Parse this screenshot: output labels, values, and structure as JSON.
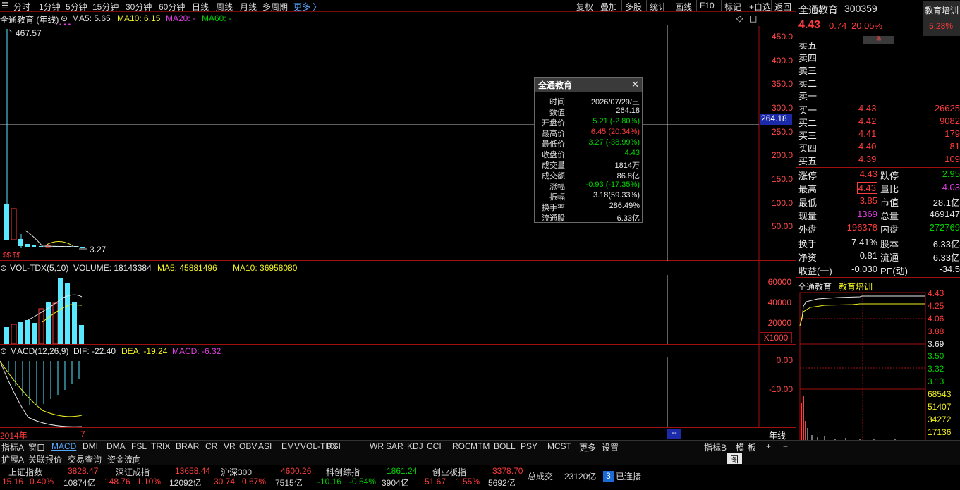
{
  "toolbar": {
    "left": [
      "分时",
      "1分钟",
      "5分钟",
      "15分钟",
      "30分钟",
      "60分钟",
      "日线",
      "周线",
      "月线",
      "多周期",
      "更多 〉"
    ],
    "right": [
      "复权",
      "叠加",
      "多股",
      "统计",
      "画线",
      "F10",
      "标记",
      "+自选",
      "返回"
    ]
  },
  "kline": {
    "title": "全通教育 (年线)",
    "ma5": "MA5: 5.65",
    "ma10": "MA10: 6.15",
    "ma20": "MA20: -",
    "ma60": "MA60: -",
    "high_label": "467.57",
    "low_label": "3.27",
    "axis": [
      "450.0",
      "400.0",
      "350.0",
      "300.0",
      "250.0",
      "200.0",
      "150.0",
      "100.0",
      "50.00"
    ],
    "crosshair_value": "264.18"
  },
  "volume": {
    "title": "VOL-TDX(5,10)",
    "vol": "VOLUME: 18143384",
    "ma5": "MA5: 45881496",
    "ma10": "MA10: 36958080",
    "axis": [
      "60000",
      "40000",
      "20000"
    ],
    "unit": "X1000"
  },
  "macd": {
    "title": "MACD(12,26,9)",
    "dif": "DIF: -22.40",
    "dea": "DEA: -19.24",
    "macd": "MACD: -6.32",
    "axis": [
      "0.00",
      "-10.00"
    ]
  },
  "timeaxis": {
    "year": "2014年",
    "mark": "7",
    "cursor": "--",
    "period": "年线"
  },
  "tooltip": {
    "title": "全通教育",
    "rows": [
      {
        "k": "时间",
        "v": "2026/07/29/三",
        "c": "white"
      },
      {
        "k": "数值",
        "v": "264.18",
        "c": "white"
      },
      {
        "k": "开盘价",
        "v": "5.21 (-2.80%)",
        "c": "green"
      },
      {
        "k": "最高价",
        "v": "6.45 (20.34%)",
        "c": "red"
      },
      {
        "k": "最低价",
        "v": "3.27 (-38.99%)",
        "c": "green"
      },
      {
        "k": "收盘价",
        "v": "4.43",
        "c": "green"
      },
      {
        "k": "成交量",
        "v": "1814万",
        "c": "white"
      },
      {
        "k": "成交额",
        "v": "86.8亿",
        "c": "white"
      },
      {
        "k": "涨幅",
        "v": "-0.93 (-17.35%)",
        "c": "green"
      },
      {
        "k": "振幅",
        "v": "3.18(59.33%)",
        "c": "white"
      },
      {
        "k": "换手率",
        "v": "286.49%",
        "c": "white"
      },
      {
        "k": "流通股",
        "v": "6.33亿",
        "c": "white"
      }
    ]
  },
  "quote": {
    "name": "全通教育",
    "code": "300359",
    "price": "4.43",
    "change": "0.74",
    "pct": "20.05%",
    "sector": "教育培训",
    "sector_pct": "5.28%",
    "sells": [
      "卖五",
      "卖四",
      "卖三",
      "卖二",
      "卖一"
    ],
    "buys": [
      {
        "k": "买一",
        "p": "4.43",
        "v": "26625"
      },
      {
        "k": "买二",
        "p": "4.42",
        "v": "9082"
      },
      {
        "k": "买三",
        "p": "4.41",
        "v": "179"
      },
      {
        "k": "买四",
        "p": "4.40",
        "v": "81"
      },
      {
        "k": "买五",
        "p": "4.39",
        "v": "109"
      }
    ],
    "stats": [
      {
        "k1": "涨停",
        "v1": "4.43",
        "c1": "red",
        "k2": "跌停",
        "v2": "2.95",
        "c2": "green"
      },
      {
        "k1": "最高",
        "v1": "4.43",
        "c1": "red",
        "k2": "量比",
        "v2": "4.03",
        "c2": "magenta"
      },
      {
        "k1": "最低",
        "v1": "3.85",
        "c1": "red",
        "k2": "市值",
        "v2": "28.1亿",
        "c2": "white"
      },
      {
        "k1": "现量",
        "v1": "1369",
        "c1": "magenta",
        "k2": "总量",
        "v2": "469147",
        "c2": "white"
      },
      {
        "k1": "外盘",
        "v1": "196378",
        "c1": "red",
        "k2": "内盘",
        "v2": "272769",
        "c2": "green"
      }
    ],
    "fin": [
      {
        "k1": "换手",
        "v1": "7.41%",
        "k2": "股本",
        "v2": "6.33亿"
      },
      {
        "k1": "净资",
        "v1": "0.81",
        "k2": "流通",
        "v2": "6.33亿"
      },
      {
        "k1": "收益(一)",
        "v1": "-0.030",
        "k2": "PE(动)",
        "v2": "-34.5"
      }
    ]
  },
  "mini": {
    "name": "全通教育",
    "sector": "教育培训",
    "price_axis": [
      "4.43",
      "4.25",
      "4.06",
      "3.88",
      "3.69",
      "3.50",
      "3.32",
      "3.13"
    ],
    "vol_axis": [
      "68543",
      "51407",
      "34272",
      "17136"
    ]
  },
  "indicators": [
    "指标A",
    "窗口",
    "MACD",
    "DMI",
    "DMA",
    "FSL",
    "TRIX",
    "BRAR",
    "CR",
    "VR",
    "OBV",
    "ASI",
    "EMV",
    "VOL-TDX",
    "RSI",
    "WR",
    "SAR",
    "KDJ",
    "CCI",
    "ROC",
    "MTM",
    "BOLL",
    "PSY",
    "MCST",
    "更多",
    "设置"
  ],
  "indicators_right": [
    "指标B",
    "模",
    "板",
    "+",
    "−"
  ],
  "tabs2": [
    "扩展A",
    "关联报价",
    "交易查询",
    "资金流向"
  ],
  "indices": [
    {
      "name": "上证指数",
      "val": "3828.47",
      "chg": "15.16",
      "pct": "0.40%",
      "amt": "10874亿",
      "c": "red"
    },
    {
      "name": "深证成指",
      "val": "13658.44",
      "chg": "148.76",
      "pct": "1.10%",
      "amt": "12092亿",
      "c": "red"
    },
    {
      "name": "沪深300",
      "val": "4600.26",
      "chg": "30.74",
      "pct": "0.67%",
      "amt": "7515亿",
      "c": "red"
    },
    {
      "name": "科创综指",
      "val": "1861.24",
      "chg": "-10.16",
      "pct": "-0.54%",
      "amt": "3904亿",
      "c": "green"
    },
    {
      "name": "创业板指",
      "val": "3378.70",
      "chg": "51.67",
      "pct": "1.55%",
      "amt": "5692亿",
      "c": "red"
    }
  ],
  "total": {
    "k": "总成交",
    "v": "23120亿",
    "conn_count": "3",
    "conn": "已连接"
  },
  "colors": {
    "up": "#ff3b3b",
    "down": "#00d200",
    "bg": "#000000",
    "frame": "#b01010"
  }
}
